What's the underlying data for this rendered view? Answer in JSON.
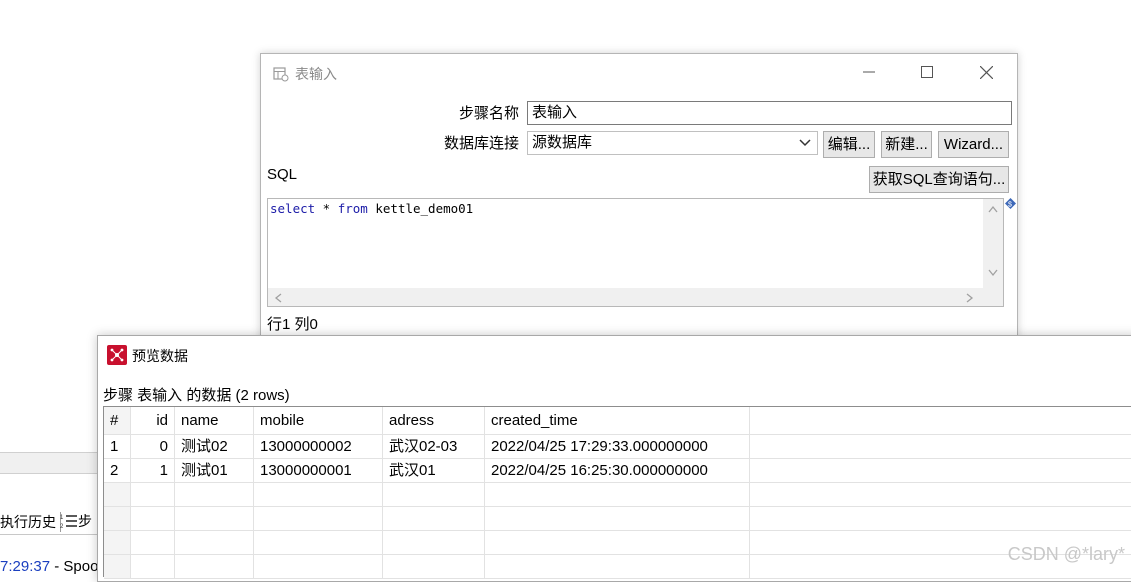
{
  "background": {
    "tab_exec_history": "执行历史",
    "tab_steps": "步",
    "log_time": "7:29:37",
    "log_text": " - Spoo"
  },
  "dialog": {
    "title": "表输入",
    "step_name_label": "步骤名称",
    "step_name_value": "表输入",
    "db_conn_label": "数据库连接",
    "db_conn_value": "源数据库",
    "btn_edit": "编辑...",
    "btn_new": "新建...",
    "btn_wizard": "Wizard...",
    "sql_label": "SQL",
    "btn_get_sql": "获取SQL查询语句...",
    "sql": {
      "kw1": "select",
      "mid": " * ",
      "kw2": "from",
      "rest": " kettle_demo01"
    },
    "cursor_pos": "行1 列0"
  },
  "preview": {
    "title": "预览数据",
    "caption": "步骤 表输入 的数据  (2 rows)",
    "columns": [
      "#",
      "id",
      "name",
      "mobile",
      "adress",
      "created_time"
    ],
    "rows": [
      [
        "1",
        "0",
        "测试02",
        "13000000002",
        "武汉02-03",
        "2022/04/25 17:29:33.000000000"
      ],
      [
        "2",
        "1",
        "测试01",
        "13000000001",
        "武汉01",
        "2022/04/25 16:25:30.000000000"
      ]
    ]
  },
  "watermark": "CSDN @*lary*",
  "icons": {
    "table_input": "table-input-icon",
    "preview": "preview-data-icon",
    "minimize": "minimize-icon",
    "maximize": "maximize-icon",
    "close": "close-icon",
    "dropdown": "chevron-down-icon",
    "list": "list-icon"
  }
}
